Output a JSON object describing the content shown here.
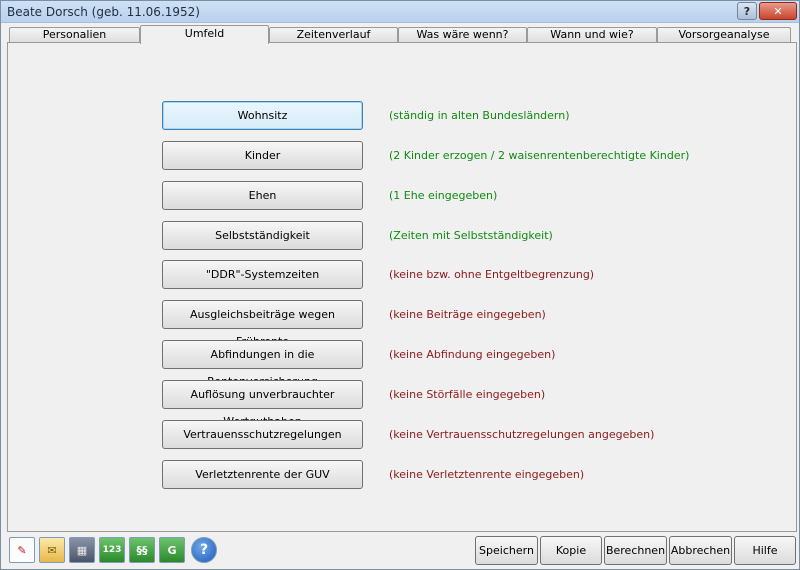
{
  "window": {
    "title": "Beate Dorsch (geb. 11.06.1952)",
    "help_glyph": "?",
    "close_glyph": "✕"
  },
  "tabs": [
    {
      "label": "Personalien"
    },
    {
      "label": "Umfeld"
    },
    {
      "label": "Zeitenverlauf"
    },
    {
      "label": "Was wäre wenn?"
    },
    {
      "label": "Wann und wie?"
    },
    {
      "label": "Vorsorgeanalyse"
    }
  ],
  "rows": [
    {
      "button": "Wohnsitz",
      "info": "(ständig in alten Bundesländern)",
      "color": "#108a10"
    },
    {
      "button": "Kinder",
      "info": "(2 Kinder erzogen / 2 waisenrentenberechtigte Kinder)",
      "color": "#108a10"
    },
    {
      "button": "Ehen",
      "info": "(1 Ehe eingegeben)",
      "color": "#108a10"
    },
    {
      "button": "Selbstständigkeit",
      "info": "(Zeiten mit Selbstständigkeit)",
      "color": "#108a10"
    },
    {
      "button": "\"DDR\"-Systemzeiten",
      "info": "(keine bzw. ohne Entgeltbegrenzung)",
      "color": "#8b1a1a"
    },
    {
      "button": "Ausgleichsbeiträge wegen Frührente",
      "info": "(keine Beiträge eingegeben)",
      "color": "#8b1a1a"
    },
    {
      "button": "Abfindungen in die Rentenversicherung",
      "info": "(keine Abfindung eingegeben)",
      "color": "#8b1a1a"
    },
    {
      "button": "Auflösung unverbrauchter Wertguthaben",
      "info": "(keine Störfälle eingegeben)",
      "color": "#8b1a1a"
    },
    {
      "button": "Vertrauensschutzregelungen",
      "info": "(keine Vertrauensschutzregelungen angegeben)",
      "color": "#8b1a1a"
    },
    {
      "button": "Verletztenrente der GUV",
      "info": "(keine Verletztenrente eingegeben)",
      "color": "#8b1a1a"
    }
  ],
  "icons": [
    {
      "name": "document-edit-icon",
      "glyph": "✎"
    },
    {
      "name": "mail-envelope-icon",
      "glyph": "✉"
    },
    {
      "name": "calculator-icon",
      "glyph": "▦"
    },
    {
      "name": "numbering-123-icon",
      "glyph": "123"
    },
    {
      "name": "paragraph-law-icon",
      "glyph": "§§"
    },
    {
      "name": "letter-g-icon",
      "glyph": "G"
    },
    {
      "name": "help-question-icon",
      "glyph": "?"
    }
  ],
  "buttons": {
    "save": "Speichern",
    "copy": "Kopie",
    "calculate": "Berechnen",
    "cancel": "Abbrechen",
    "help": "Hilfe"
  }
}
